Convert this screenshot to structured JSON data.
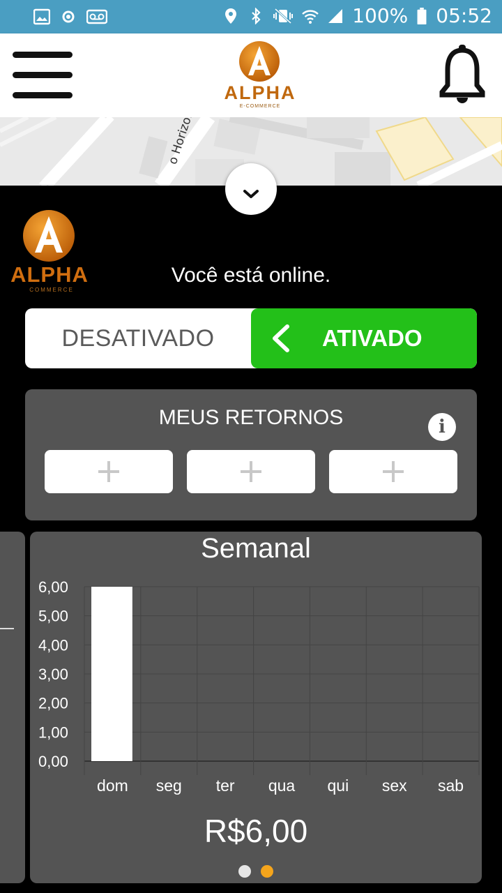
{
  "status_bar": {
    "battery": "100%",
    "time": "05:52"
  },
  "header": {
    "logo_text": "ALPHA",
    "logo_sub": "E-COMMERCE"
  },
  "map": {
    "street_label": "o Horizonte"
  },
  "body_logo": {
    "text": "ALPHA",
    "sub": "COMMERCE"
  },
  "online_text": "Você está online.",
  "toggle": {
    "off_label": "DESATIVADO",
    "on_label": "ATIVADO",
    "state": "on",
    "on_color": "#23c019"
  },
  "retornos": {
    "title": "MEUS RETORNOS",
    "info_glyph": "i",
    "slots": 3
  },
  "chart_data": {
    "type": "bar",
    "title": "Semanal",
    "categories": [
      "dom",
      "seg",
      "ter",
      "qua",
      "qui",
      "sex",
      "sab"
    ],
    "values": [
      6,
      0,
      0,
      0,
      0,
      0,
      0
    ],
    "ylim": [
      0,
      6
    ],
    "yticks": [
      "0,00",
      "1,00",
      "2,00",
      "3,00",
      "4,00",
      "5,00",
      "6,00"
    ],
    "grid": true,
    "bar_color": "#ffffff"
  },
  "chart_total": "R$6,00",
  "pager": {
    "count": 2,
    "active": 1,
    "active_color": "#f5a51c",
    "inactive_color": "#e6e6e6"
  },
  "colors": {
    "status_bar": "#4a9ec2",
    "card": "#545454",
    "logo_orange": "#e07a10"
  }
}
